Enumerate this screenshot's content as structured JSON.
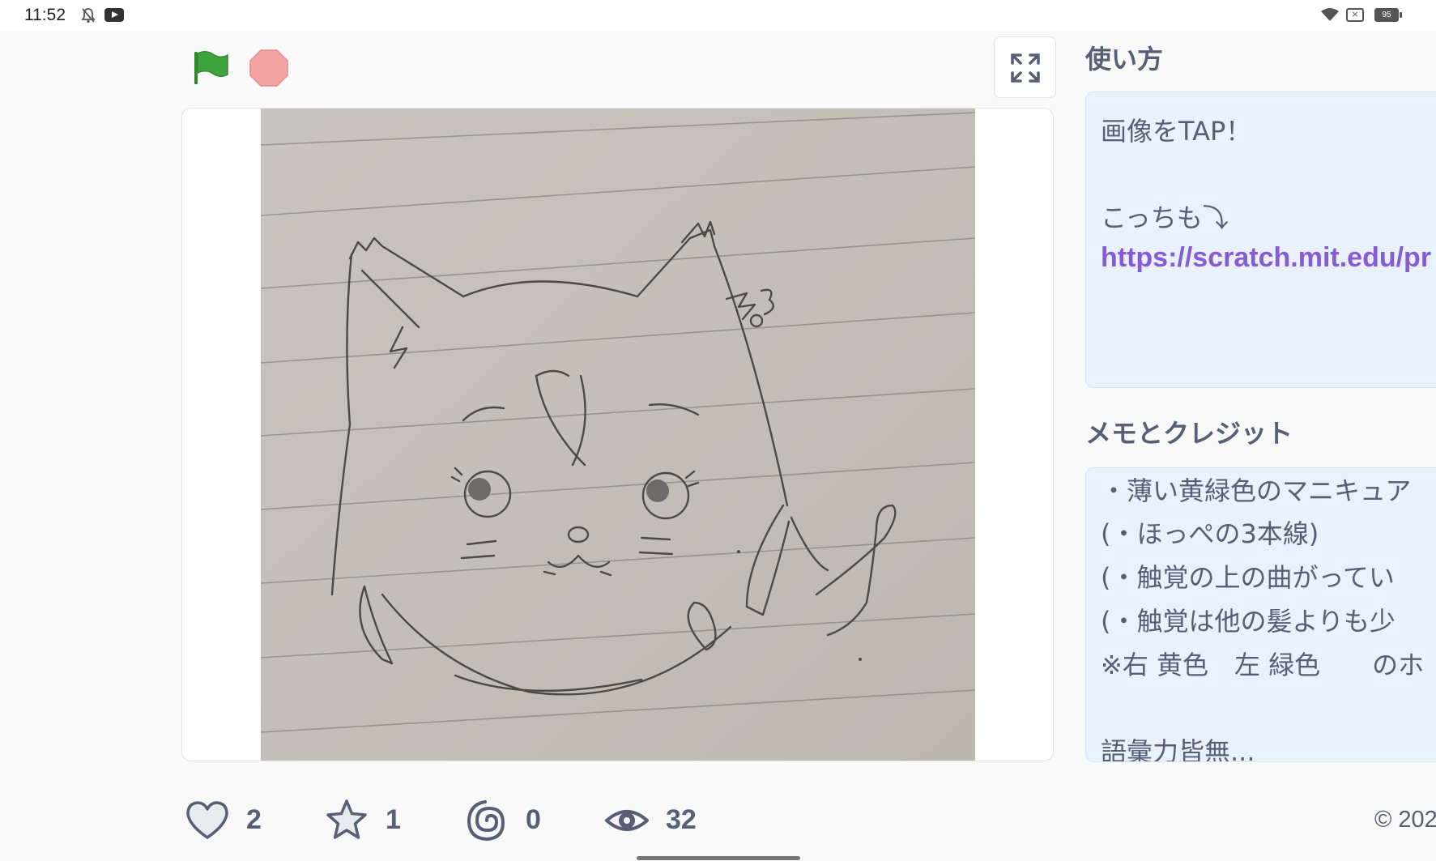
{
  "status_bar": {
    "time": "11:52",
    "battery": "95",
    "icons": [
      "bell-off-icon",
      "youtube-icon",
      "wifi-icon",
      "sim-icon",
      "battery-icon"
    ]
  },
  "player": {
    "green_flag_icon": "green-flag-icon",
    "stop_icon": "stop-sign-icon",
    "fullscreen_icon": "fullscreen-icon",
    "flag_color": "#3fa43f",
    "stop_color": "#f2a3a3"
  },
  "instructions": {
    "title": "使い方",
    "lines": [
      "画像をTAP！",
      "こっちも⤵",
      "https://scratch.mit.edu/pr"
    ]
  },
  "notes": {
    "title": "メモとクレジット",
    "lines": [
      "・薄い黄緑色のマニキュア",
      "(・ほっぺの3本線)",
      "(・触覚の上の曲がってい",
      "(・触覚は他の髪よりも少",
      "※右 黄色　左 緑色　　のホ",
      "語彙力皆無..."
    ]
  },
  "stats": {
    "loves": "2",
    "favorites": "1",
    "remixes": "0",
    "views": "32"
  },
  "footer": {
    "copyright": "© 202"
  },
  "colors": {
    "link": "#855cd6",
    "panel_bg": "#e9f1fc",
    "text": "#575e75"
  }
}
